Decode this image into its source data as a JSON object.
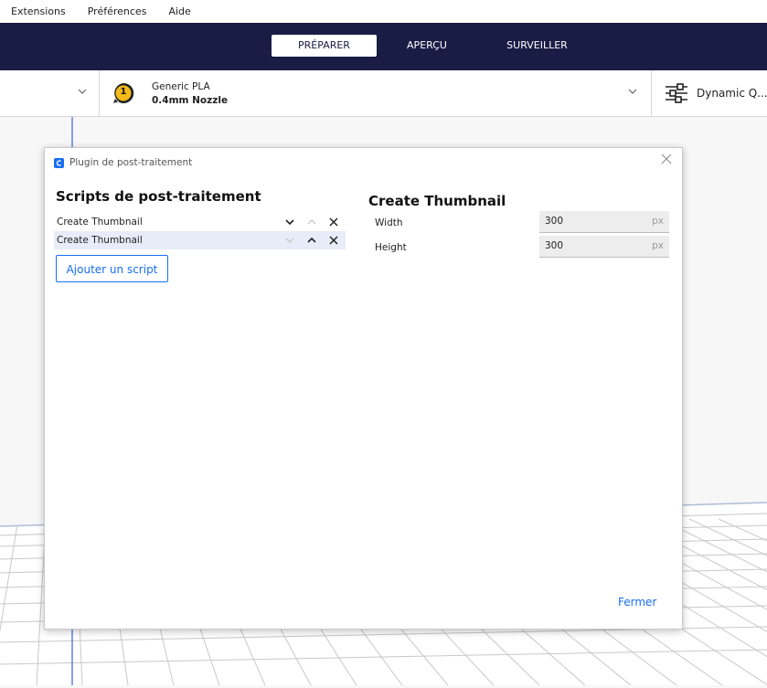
{
  "menu": {
    "items": [
      "Extensions",
      "Préférences",
      "Aide"
    ]
  },
  "stages": {
    "tabs": [
      "PRÉPARER",
      "APERÇU",
      "SURVEILLER"
    ],
    "active": "PRÉPARER"
  },
  "settings": {
    "extruder_number": "1",
    "material": "Generic PLA",
    "nozzle": "0.4mm Nozzle",
    "profile": "Dynamic Q..."
  },
  "dialog": {
    "title": "Plugin de post-traitement",
    "left_heading": "Scripts de post-traitement",
    "scripts": [
      {
        "name": "Create Thumbnail"
      },
      {
        "name": "Create Thumbnail"
      }
    ],
    "add_script_label": "Ajouter un script",
    "right_heading": "Create Thumbnail",
    "fields": [
      {
        "label": "Width",
        "value": "300",
        "unit": "px"
      },
      {
        "label": "Height",
        "value": "300",
        "unit": "px"
      }
    ],
    "close_label": "Fermer"
  },
  "colors": {
    "stage_bar": "#191c45",
    "accent": "#196ef0",
    "extruder_badge": "#f3ba1a"
  }
}
